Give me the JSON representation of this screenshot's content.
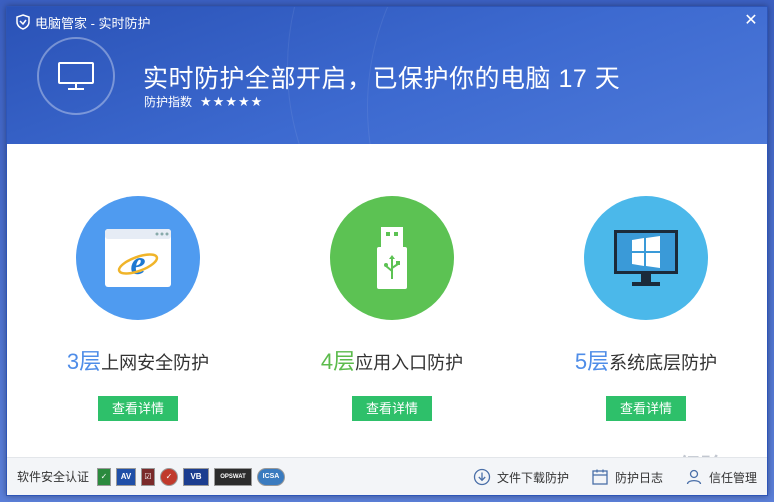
{
  "window": {
    "title": "电脑管家 - 实时防护",
    "close_glyph": "✕"
  },
  "header": {
    "headline": "实时防护全部开启，已保护你的电脑 17 天",
    "index_label": "防护指数",
    "stars": "★★★★★"
  },
  "features": [
    {
      "num": "3层",
      "title": "上网安全防护",
      "button": "查看详情",
      "color": "#4f9bf0",
      "num_color": "#4f8de8",
      "icon": "ie-browser-icon"
    },
    {
      "num": "4层",
      "title": "应用入口防护",
      "button": "查看详情",
      "color": "#5cc253",
      "num_color": "#5cbb4c",
      "icon": "usb-drive-icon"
    },
    {
      "num": "5层",
      "title": "系统底层防护",
      "button": "查看详情",
      "color": "#4bb8ea",
      "num_color": "#4f8de8",
      "icon": "windows-monitor-icon"
    }
  ],
  "footer": {
    "cert_label": "软件安全认证",
    "links": [
      {
        "label": "文件下载防护",
        "icon": "download-icon"
      },
      {
        "label": "防护日志",
        "icon": "calendar-icon"
      },
      {
        "label": "信任管理",
        "icon": "user-icon"
      }
    ],
    "badges": [
      {
        "text": "✓",
        "bg": "#2b8a3e"
      },
      {
        "text": "AV",
        "bg": "#1f4fa8"
      },
      {
        "text": "☑",
        "bg": "#7a2a2a"
      },
      {
        "text": "✓",
        "bg": "#c0392b"
      },
      {
        "text": "VB",
        "bg": "#1b3d8f"
      },
      {
        "text": "OPSWAT",
        "bg": "#2c2c2c"
      },
      {
        "text": "ICSA",
        "bg": "#3a7bbf"
      }
    ]
  },
  "watermark": "Baidu 经验",
  "colors": {
    "header": "#3360c6",
    "button": "#2ec06a"
  }
}
